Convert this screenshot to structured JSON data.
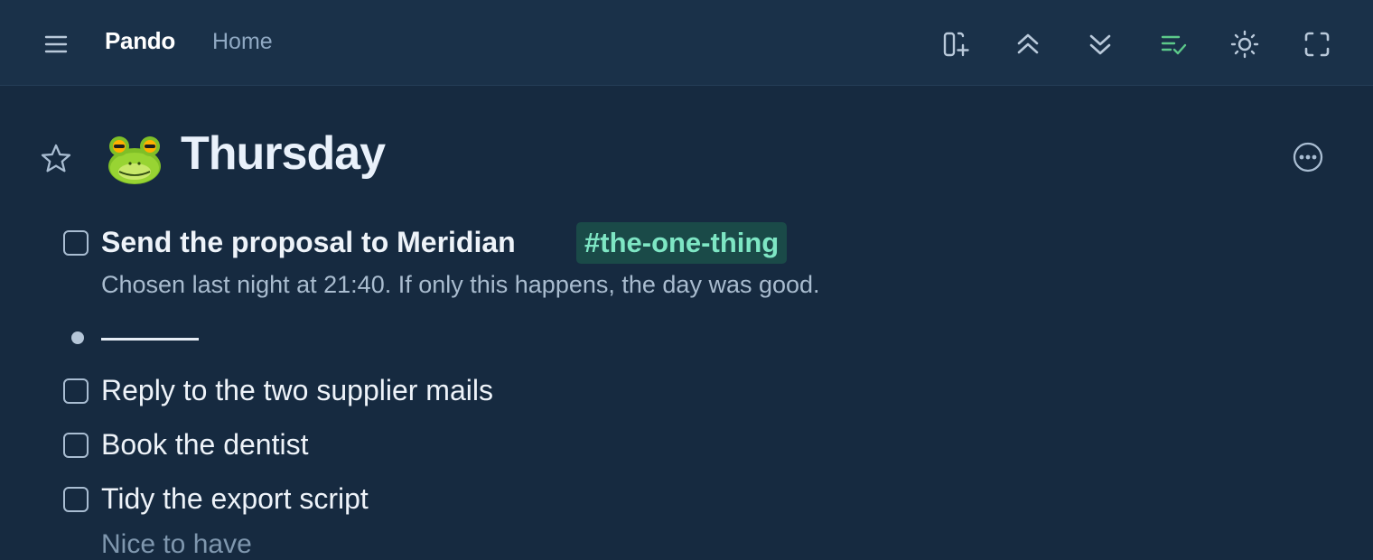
{
  "header": {
    "brand": "Pando",
    "breadcrumb": "Home",
    "menu_icon": "hamburger-menu-icon",
    "actions": [
      {
        "name": "add-panel-icon"
      },
      {
        "name": "collapse-all-icon"
      },
      {
        "name": "expand-all-icon"
      },
      {
        "name": "task-list-check-icon",
        "color": "#5cc98a"
      },
      {
        "name": "brightness-icon"
      },
      {
        "name": "fullscreen-icon"
      }
    ]
  },
  "page": {
    "favorite_icon": "star-outline-icon",
    "emoji": "frog",
    "title": "Thursday",
    "more_icon": "more-options-icon"
  },
  "items": {
    "main_task": {
      "text": "Send the proposal to Meridian",
      "tag": "#the-one-thing",
      "note": "Chosen last night at 21:40. If only this happens, the day was good.",
      "checked": false
    },
    "tasks": [
      {
        "text": "Reply to the two supplier mails",
        "checked": false
      },
      {
        "text": "Book the dentist",
        "checked": false
      },
      {
        "text": "Tidy the export script",
        "checked": false
      }
    ],
    "partial_line": "Nice to have"
  },
  "colors": {
    "background": "#162a40",
    "topbar": "#1a3149",
    "tag_bg": "#1a4a48",
    "tag_text": "#7ee6c4",
    "accent_green": "#5cc98a"
  }
}
